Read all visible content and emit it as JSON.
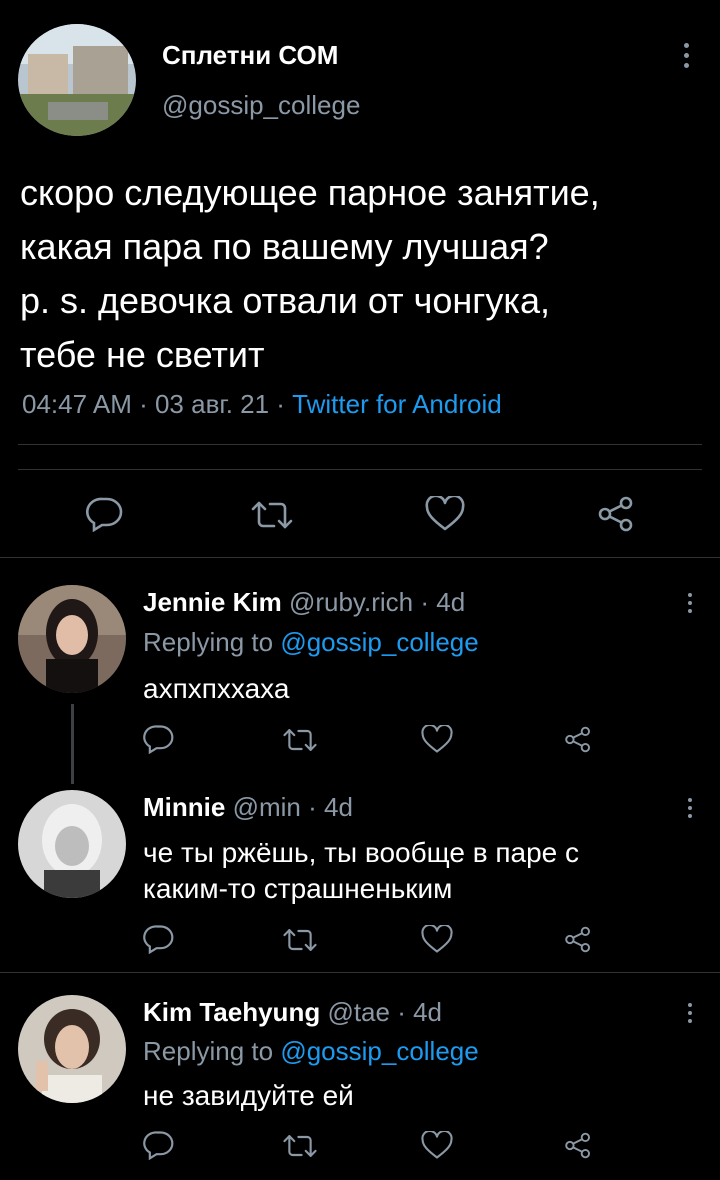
{
  "main_tweet": {
    "author_name": "Сплетни СОМ",
    "author_handle": "@gossip_college",
    "text_lines": [
      "скоро следующее парное занятие,",
      "какая пара по вашему лучшая?",
      "p. s. девочка отвали от чонгука,",
      "тебе не светит"
    ],
    "time": "04:47 AM",
    "sep1": " · ",
    "date": "03 авг. 21",
    "sep2": " · ",
    "source": "Twitter for Android"
  },
  "replies": [
    {
      "name": "Jennie Kim",
      "handle": "@ruby.rich",
      "age": " · 4d",
      "replying_prefix": "Replying to ",
      "replying_to": "@gossip_college",
      "lines": [
        "ахпхпххаха"
      ]
    },
    {
      "name": "Minnie",
      "handle": "@min",
      "age": " · 4d",
      "lines": [
        "че ты ржёшь, ты вообще в паре с",
        "каким-то страшненьким"
      ]
    },
    {
      "name": "Kim Taehyung",
      "handle": "@tae",
      "age": " · 4d",
      "replying_prefix": "Replying to ",
      "replying_to": "@gossip_college",
      "lines": [
        "не завидуйте ей"
      ]
    }
  ],
  "icons": {
    "reply": "reply-icon",
    "retweet": "retweet-icon",
    "like": "like-icon",
    "share": "share-icon",
    "more": "more-vertical-icon"
  },
  "colors": {
    "background": "#000000",
    "text": "#ffffff",
    "secondary": "#8b98a5",
    "link": "#1d9bf0",
    "divider": "#2f3336"
  }
}
